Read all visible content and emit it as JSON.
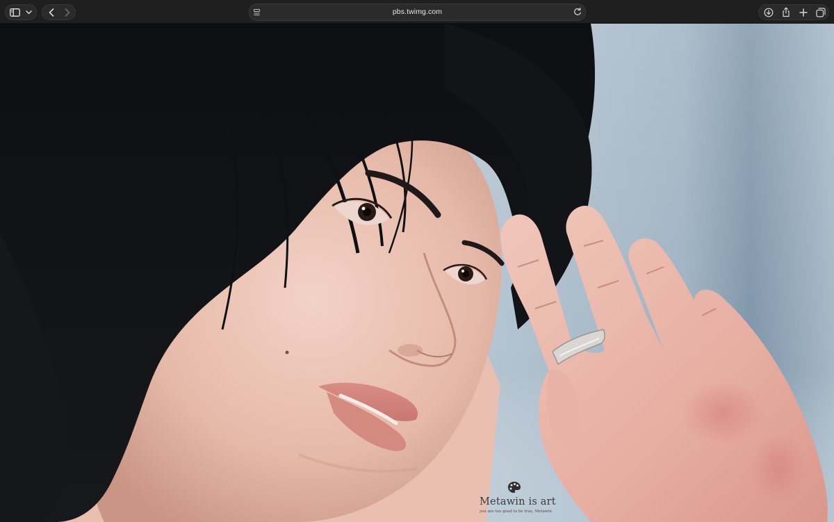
{
  "window": {
    "url": "pbs.twimg.com"
  },
  "toolbar": {
    "left_icons": [
      "sidebar-icon",
      "chevron-down-icon",
      "back-icon",
      "forward-icon"
    ],
    "address_icons": [
      "page-menu-icon",
      "reload-icon"
    ],
    "right_icons": [
      "download-icon",
      "share-icon",
      "new-tab-icon",
      "tab-overview-icon"
    ]
  },
  "image": {
    "watermark_brand": "Metawin is art",
    "watermark_tagline": "you are too good to be true, Metawin"
  },
  "colors": {
    "toolbar_bg": "#1f1f1f",
    "address_bg": "#2b2b2b",
    "icon": "#d8d8d8",
    "hair": "#101215",
    "skin": "#e7bfb0",
    "background_blue": "#a9bccb"
  }
}
